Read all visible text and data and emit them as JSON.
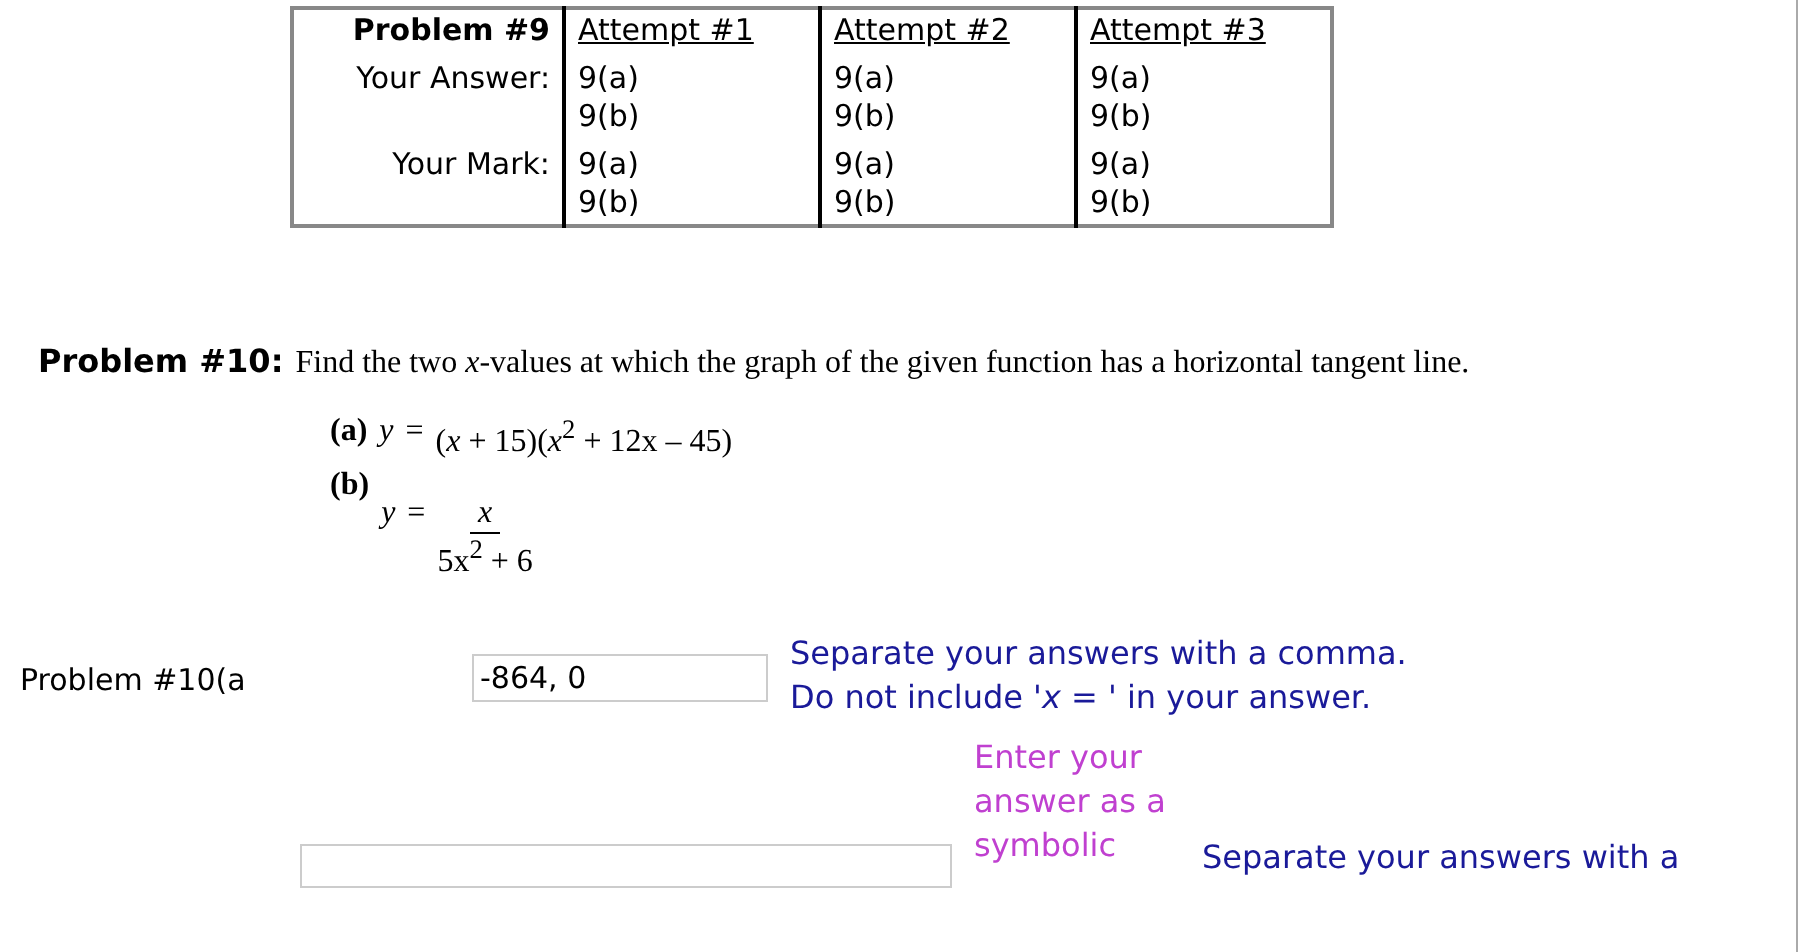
{
  "results_table": {
    "title": "Problem #9",
    "row_labels": [
      "Your Answer:",
      "Your Mark:"
    ],
    "attempts": [
      {
        "label": "Attempt #1",
        "answers": [
          "9(a)",
          "9(b)"
        ],
        "marks": [
          "9(a)",
          "9(b)"
        ]
      },
      {
        "label": "Attempt #2",
        "answers": [
          "9(a)",
          "9(b)"
        ],
        "marks": [
          "9(a)",
          "9(b)"
        ]
      },
      {
        "label": "Attempt #3",
        "answers": [
          "9(a)",
          "9(b)"
        ],
        "marks": [
          "9(a)",
          "9(b)"
        ]
      }
    ]
  },
  "problem": {
    "title": "Problem #10:",
    "instruction": "Find the two *x*-values at which the graph of the given function has a horizontal tangent line.",
    "parts": [
      {
        "kind": "inline",
        "label": "(a)",
        "lhs": "*y*",
        "equals": "=",
        "rhs": "(*x* + 15)(*x*$^{2}$ + 12x – 45)"
      },
      {
        "kind": "fraction",
        "label": "(b)",
        "lhs": "*y*",
        "equals": "=",
        "numerator": "*x*",
        "denominator": "5x$^{2}$ + 6"
      }
    ]
  },
  "answer_a": {
    "label": "Problem #10(a",
    "value": "-864, 0",
    "hints": [
      "Separate your answers with a comma.",
      "Do not include '*x* = ' in your answer."
    ]
  },
  "answer_b": {
    "note": "Enter your answer as a symbolic",
    "hint": "Separate your answers with a"
  }
}
